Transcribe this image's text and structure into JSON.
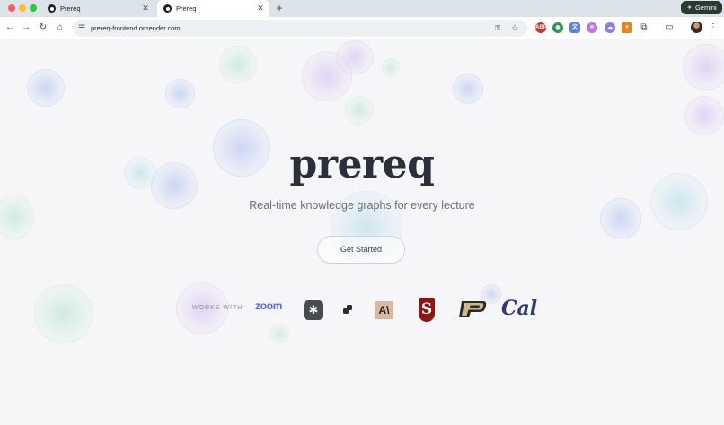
{
  "tabs": [
    {
      "title": "Prereq",
      "active": false
    },
    {
      "title": "Prereq",
      "active": true
    }
  ],
  "new_tab_label": "+",
  "gemini_label": "Gemini",
  "address_bar": {
    "url": "prereq-frontend.onrender.com"
  },
  "hero": {
    "title": "prereq",
    "tagline": "Real-time knowledge graphs for every lecture",
    "cta_label": "Get Started"
  },
  "partners": {
    "label": "WORKS WITH",
    "zoom_label": "zoom",
    "anthropic_mark": "A\\",
    "stanford_mark": "S",
    "cal_label": "Cal",
    "items": [
      "zoom",
      "perplexity-logo",
      "two-tone-logo",
      "anthropic-logo",
      "stanford-logo",
      "purdue-logo",
      "cal-logo"
    ]
  },
  "colors": {
    "accent_zoom": "#4a6cf7",
    "stanford_red": "#8c1515",
    "cal_blue": "#2d3b77",
    "title_text": "#2a2f3b"
  }
}
